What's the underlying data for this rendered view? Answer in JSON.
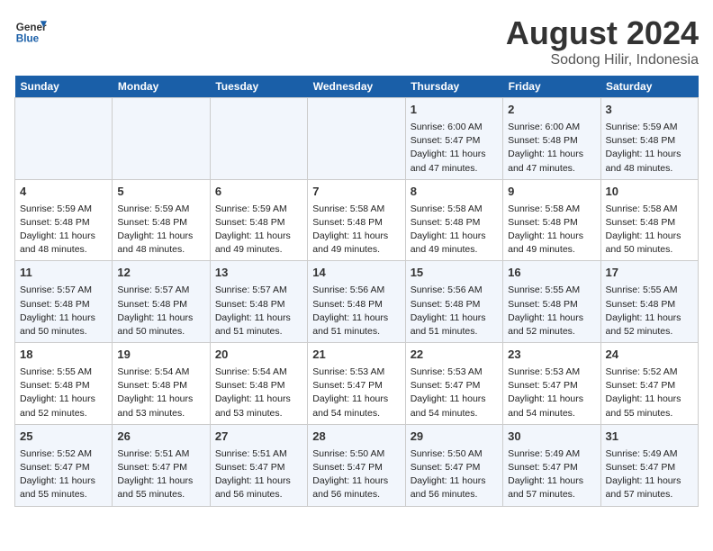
{
  "header": {
    "logo_line1": "General",
    "logo_line2": "Blue",
    "title": "August 2024",
    "subtitle": "Sodong Hilir, Indonesia"
  },
  "days_of_week": [
    "Sunday",
    "Monday",
    "Tuesday",
    "Wednesday",
    "Thursday",
    "Friday",
    "Saturday"
  ],
  "weeks": [
    [
      {
        "day": "",
        "info": ""
      },
      {
        "day": "",
        "info": ""
      },
      {
        "day": "",
        "info": ""
      },
      {
        "day": "",
        "info": ""
      },
      {
        "day": "1",
        "info": "Sunrise: 6:00 AM\nSunset: 5:47 PM\nDaylight: 11 hours and 47 minutes."
      },
      {
        "day": "2",
        "info": "Sunrise: 6:00 AM\nSunset: 5:48 PM\nDaylight: 11 hours and 47 minutes."
      },
      {
        "day": "3",
        "info": "Sunrise: 5:59 AM\nSunset: 5:48 PM\nDaylight: 11 hours and 48 minutes."
      }
    ],
    [
      {
        "day": "4",
        "info": "Sunrise: 5:59 AM\nSunset: 5:48 PM\nDaylight: 11 hours and 48 minutes."
      },
      {
        "day": "5",
        "info": "Sunrise: 5:59 AM\nSunset: 5:48 PM\nDaylight: 11 hours and 48 minutes."
      },
      {
        "day": "6",
        "info": "Sunrise: 5:59 AM\nSunset: 5:48 PM\nDaylight: 11 hours and 49 minutes."
      },
      {
        "day": "7",
        "info": "Sunrise: 5:58 AM\nSunset: 5:48 PM\nDaylight: 11 hours and 49 minutes."
      },
      {
        "day": "8",
        "info": "Sunrise: 5:58 AM\nSunset: 5:48 PM\nDaylight: 11 hours and 49 minutes."
      },
      {
        "day": "9",
        "info": "Sunrise: 5:58 AM\nSunset: 5:48 PM\nDaylight: 11 hours and 49 minutes."
      },
      {
        "day": "10",
        "info": "Sunrise: 5:58 AM\nSunset: 5:48 PM\nDaylight: 11 hours and 50 minutes."
      }
    ],
    [
      {
        "day": "11",
        "info": "Sunrise: 5:57 AM\nSunset: 5:48 PM\nDaylight: 11 hours and 50 minutes."
      },
      {
        "day": "12",
        "info": "Sunrise: 5:57 AM\nSunset: 5:48 PM\nDaylight: 11 hours and 50 minutes."
      },
      {
        "day": "13",
        "info": "Sunrise: 5:57 AM\nSunset: 5:48 PM\nDaylight: 11 hours and 51 minutes."
      },
      {
        "day": "14",
        "info": "Sunrise: 5:56 AM\nSunset: 5:48 PM\nDaylight: 11 hours and 51 minutes."
      },
      {
        "day": "15",
        "info": "Sunrise: 5:56 AM\nSunset: 5:48 PM\nDaylight: 11 hours and 51 minutes."
      },
      {
        "day": "16",
        "info": "Sunrise: 5:55 AM\nSunset: 5:48 PM\nDaylight: 11 hours and 52 minutes."
      },
      {
        "day": "17",
        "info": "Sunrise: 5:55 AM\nSunset: 5:48 PM\nDaylight: 11 hours and 52 minutes."
      }
    ],
    [
      {
        "day": "18",
        "info": "Sunrise: 5:55 AM\nSunset: 5:48 PM\nDaylight: 11 hours and 52 minutes."
      },
      {
        "day": "19",
        "info": "Sunrise: 5:54 AM\nSunset: 5:48 PM\nDaylight: 11 hours and 53 minutes."
      },
      {
        "day": "20",
        "info": "Sunrise: 5:54 AM\nSunset: 5:48 PM\nDaylight: 11 hours and 53 minutes."
      },
      {
        "day": "21",
        "info": "Sunrise: 5:53 AM\nSunset: 5:47 PM\nDaylight: 11 hours and 54 minutes."
      },
      {
        "day": "22",
        "info": "Sunrise: 5:53 AM\nSunset: 5:47 PM\nDaylight: 11 hours and 54 minutes."
      },
      {
        "day": "23",
        "info": "Sunrise: 5:53 AM\nSunset: 5:47 PM\nDaylight: 11 hours and 54 minutes."
      },
      {
        "day": "24",
        "info": "Sunrise: 5:52 AM\nSunset: 5:47 PM\nDaylight: 11 hours and 55 minutes."
      }
    ],
    [
      {
        "day": "25",
        "info": "Sunrise: 5:52 AM\nSunset: 5:47 PM\nDaylight: 11 hours and 55 minutes."
      },
      {
        "day": "26",
        "info": "Sunrise: 5:51 AM\nSunset: 5:47 PM\nDaylight: 11 hours and 55 minutes."
      },
      {
        "day": "27",
        "info": "Sunrise: 5:51 AM\nSunset: 5:47 PM\nDaylight: 11 hours and 56 minutes."
      },
      {
        "day": "28",
        "info": "Sunrise: 5:50 AM\nSunset: 5:47 PM\nDaylight: 11 hours and 56 minutes."
      },
      {
        "day": "29",
        "info": "Sunrise: 5:50 AM\nSunset: 5:47 PM\nDaylight: 11 hours and 56 minutes."
      },
      {
        "day": "30",
        "info": "Sunrise: 5:49 AM\nSunset: 5:47 PM\nDaylight: 11 hours and 57 minutes."
      },
      {
        "day": "31",
        "info": "Sunrise: 5:49 AM\nSunset: 5:47 PM\nDaylight: 11 hours and 57 minutes."
      }
    ]
  ]
}
